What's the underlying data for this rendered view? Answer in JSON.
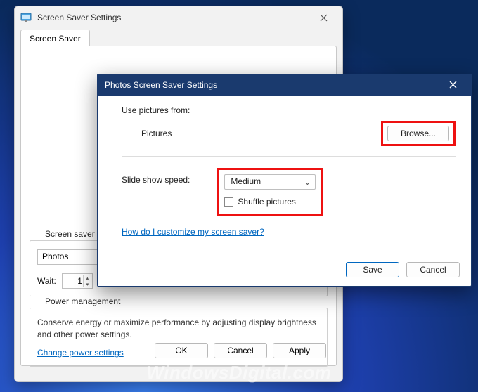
{
  "parent": {
    "title": "Screen Saver Settings",
    "tab": "Screen Saver",
    "group_label": "Screen saver",
    "selected_saver": "Photos",
    "wait_label": "Wait:",
    "wait_value": "1",
    "pm_group_label": "Power management",
    "pm_text": "Conserve energy or maximize performance by adjusting display brightness and other power settings.",
    "pm_link": "Change power settings",
    "buttons": {
      "ok": "OK",
      "cancel": "Cancel",
      "apply": "Apply"
    }
  },
  "child": {
    "title": "Photos Screen Saver Settings",
    "use_label": "Use pictures from:",
    "folder_name": "Pictures",
    "browse": "Browse...",
    "speed_label": "Slide show speed:",
    "speed_value": "Medium",
    "shuffle": "Shuffle pictures",
    "customize_link": "How do I customize my screen saver?",
    "buttons": {
      "save": "Save",
      "cancel": "Cancel"
    }
  },
  "watermark": "WindowsDigital.com"
}
